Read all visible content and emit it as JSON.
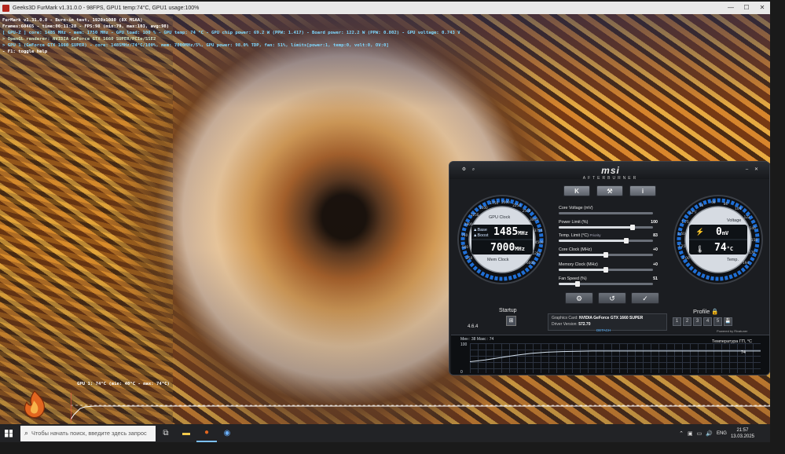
{
  "furmark": {
    "window_title": "Geeks3D FurMark v1.31.0.0 - 98FPS, GPU1 temp:74°C, GPU1 usage:100%",
    "hud_lines": [
      "FurMark v1.31.0.0 - Burn-in test, 1920x1080 (8X MSAA)",
      "Frames:60465 - time:00:11:28 - FPS:98 (min:79, max:103, avg:98)",
      "[ GPU-Z ] core: 1485 MHz - mem: 1750 MHz - GPU load: 100 % - GPU temp: 74 °C - GPU chip power: 69.2 W (PPW: 1.417) - Board power: 122.2 W (PPW: 0.802) - GPU voltage: 0.743 V",
      "> OpenGL renderer: NVIDIA GeForce GTX 1660 SUPER/PCIe/SSE2",
      "> GPU 1 (GeForce GTX 1660 SUPER) - core: 1485MHz/74°C/100%, mem: 7000MHz/5%, GPU power: 98.0% TDP, fan: 51%, limits[power:1, temp:0, volt:0, OV:0]",
      "- F1: toggle help"
    ],
    "graph_label": "GPU 1: 74°C (min: 40°C - max: 74°C)"
  },
  "afterburner": {
    "brand": "msi",
    "subtitle": "AFTERBURNER",
    "top_left_icons": [
      "settings-icon",
      "search-icon"
    ],
    "mode_buttons": [
      "K",
      "⚒",
      "i"
    ],
    "left_gauge": {
      "label_top": "GPU Clock",
      "base_label": "▲Base",
      "boost_label": "▲Boost",
      "gpu_clock_value": "1485",
      "gpu_clock_unit": "MHz",
      "mem_clock_value": "7000",
      "mem_clock_unit": "MHz",
      "label_bottom": "Mem Clock",
      "ticks": [
        "250",
        "500",
        "750",
        "1000",
        "1250",
        "1500",
        "1750",
        "2000",
        "2250",
        "2500",
        "3000",
        "3750",
        "4500",
        "5250",
        "6000"
      ]
    },
    "right_gauge": {
      "label_voltage": "Voltage",
      "voltage_value": "0",
      "voltage_unit": "mV",
      "temp_value": "74",
      "temp_unit": "°C",
      "label_temp": "Temp.",
      "ticks": [
        "1.00",
        "1.25",
        "1.50",
        "1.75",
        "32°F",
        "50",
        "68",
        "86",
        "104",
        "122",
        "140",
        "158",
        "176",
        "194"
      ]
    },
    "sliders": [
      {
        "label": "Core Voltage (mV)",
        "value": "",
        "fill": 0
      },
      {
        "label": "Power Limit (%)",
        "value": "100",
        "fill": 0.78
      },
      {
        "label": "Temp. Limit (°C)",
        "value": "83",
        "fill": 0.72,
        "extra": "Priority"
      },
      {
        "label": "Core Clock (MHz)",
        "value": "+0",
        "fill": 0.5
      },
      {
        "label": "Memory Clock (MHz)",
        "value": "+0",
        "fill": 0.5
      },
      {
        "label": "Fan Speed (%)",
        "value": "51",
        "fill": 0.2
      }
    ],
    "action_buttons": [
      "⚙",
      "↺",
      "✓"
    ],
    "version": "4.6.4",
    "startup_label": "Startup",
    "graphics_card_label": "Graphics Card:",
    "graphics_card_value": "NVIDIA GeForce GTX 1660 SUPER",
    "driver_label": "Driver Version:",
    "driver_value": "572.70",
    "detach_label": "DETACH",
    "profile_label": "Profile",
    "profile_slots": [
      "1",
      "2",
      "3",
      "4",
      "5"
    ],
    "powered_by": "Powered by Rivatuner",
    "monitor": {
      "minmax": "Мин : 38   Макс : 74",
      "scale_top": "100",
      "scale_bottom": "0",
      "series_name": "Температура ГП, °C",
      "current_value": "74",
      "history": [
        38,
        44,
        52,
        60,
        66,
        70,
        72,
        73,
        74,
        74,
        74,
        74,
        74,
        74,
        74,
        74,
        74,
        74,
        74,
        74
      ]
    }
  },
  "taskbar": {
    "search_placeholder": "Чтобы начать поиск, введите здесь запрос",
    "language": "ENG",
    "time": "21:57",
    "date": "13.03.2025"
  },
  "colors": {
    "accent": "#4fb0ff",
    "gauge_ring": "#2d6fd0",
    "gauge_face": "#d8dde4"
  }
}
